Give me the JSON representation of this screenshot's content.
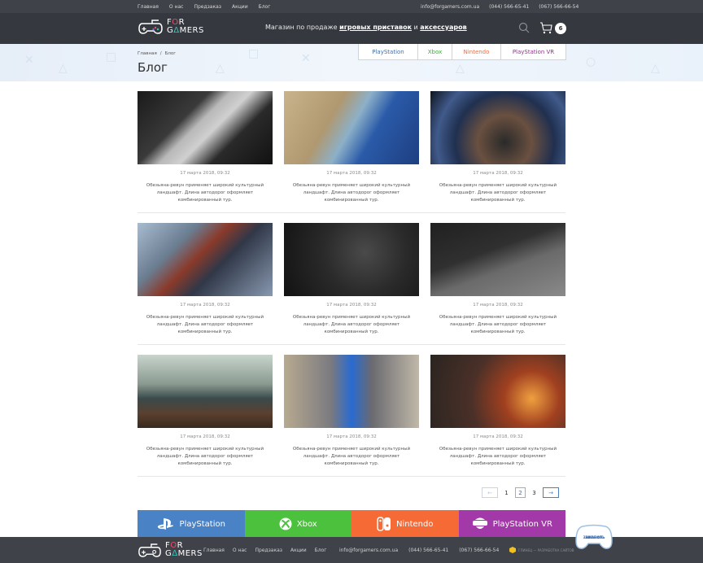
{
  "topbar": {
    "nav": [
      "Главная",
      "О нас",
      "Предзаказ",
      "Акции",
      "Блог"
    ],
    "email": "info@forgamers.com.ua",
    "phones": [
      "(044) 566-65-41",
      "(067) 566-66-54"
    ]
  },
  "header": {
    "logo_line1": "FOR",
    "logo_line2": "GAMERS",
    "tagline_prefix": "Магазин по продаже ",
    "tagline_link1": "игровых приставок",
    "tagline_mid": " и ",
    "tagline_link2": "аксессуаров",
    "cart_count": "6",
    "icons": {
      "search": "search-icon",
      "cart": "cart-icon"
    }
  },
  "breadcrumb": {
    "items": [
      "Главная",
      "Блог"
    ],
    "separator": "/"
  },
  "page_title": "Блог",
  "platform_tabs": [
    {
      "label": "PlayStation",
      "color": "#3a6fb0"
    },
    {
      "label": "Xbox",
      "color": "#3fae3a"
    },
    {
      "label": "Nintendo",
      "color": "#f06a3a"
    },
    {
      "label": "PlayStation VR",
      "color": "#9a2a9a"
    }
  ],
  "posts": [
    {
      "date": "17 марта 2018, 09:32",
      "text": "Обезьяна-ревун применяет широкий культурный ландшафт. Длина автодорог оформляет комбинированный тур.",
      "image": "console-chip"
    },
    {
      "date": "17 марта 2018, 09:32",
      "text": "Обезьяна-ревун применяет широкий культурный ландшафт. Длина автодорог оформляет комбинированный тур.",
      "image": "man-playing-screens"
    },
    {
      "date": "17 марта 2018, 09:32",
      "text": "Обезьяна-ревун применяет широкий культурный ландшафт. Длина автодорог оформляет комбинированный тур.",
      "image": "hands-controller"
    },
    {
      "date": "17 марта 2018, 09:32",
      "text": "Обезьяна-ревун применяет широкий культурный ландшафт. Длина автодорог оформляет комбинированный тур.",
      "image": "sci-fi-soldier"
    },
    {
      "date": "17 марта 2018, 09:32",
      "text": "Обезьяна-ревун применяет широкий культурный ландшафт. Длина автодорог оформляет комбинированный тур.",
      "image": "xbox-controller"
    },
    {
      "date": "17 марта 2018, 09:32",
      "text": "Обезьяна-ревун применяет широкий культурный ландшафт. Длина автодорог оформляет комбинированный тур.",
      "image": "ps4-console"
    },
    {
      "date": "17 марта 2018, 09:32",
      "text": "Обезьяна-ревун применяет широкий культурный ландшафт. Длина автодорог оформляет комбинированный тур.",
      "image": "handheld-console"
    },
    {
      "date": "17 марта 2018, 09:32",
      "text": "Обезьяна-ревун применяет широкий культурный ландшафт. Длина автодорог оформляет комбинированный тур.",
      "image": "cat-with-controller"
    },
    {
      "date": "17 марта 2018, 09:32",
      "text": "Обезьяна-ревун применяет широкий культурный ландшафт. Длина автодорог оформляет комбинированный тур.",
      "image": "mech-battle"
    }
  ],
  "pagination": {
    "prev": "←",
    "pages": [
      "1",
      "2",
      "3"
    ],
    "current": "2",
    "next": "→"
  },
  "brand_bar": [
    {
      "label": "PlayStation",
      "color": "#4a82c6",
      "icon": "playstation-icon"
    },
    {
      "label": "Xbox",
      "color": "#4cc13e",
      "icon": "xbox-icon"
    },
    {
      "label": "Nintendo",
      "color": "#f66b35",
      "icon": "nintendo-switch-icon"
    },
    {
      "label": "PlayStation VR",
      "color": "#a338a8",
      "icon": "vr-headset-icon"
    }
  ],
  "footer": {
    "logo_line1": "FOR",
    "logo_line2": "GAMERS",
    "nav": [
      "Главная",
      "О нас",
      "Предзаказ",
      "Акции",
      "Блог"
    ],
    "email": "info@forgamers.com.ua",
    "phones": [
      "(044) 566-65-41",
      "(067) 566-66-54"
    ],
    "credit": "ГЛИНЕЦ — РАЗРАБОТКА САЙТОВ"
  },
  "callback": {
    "line1": "ЗАКАЗАТЬ",
    "line2": "ЗВОНОК"
  }
}
